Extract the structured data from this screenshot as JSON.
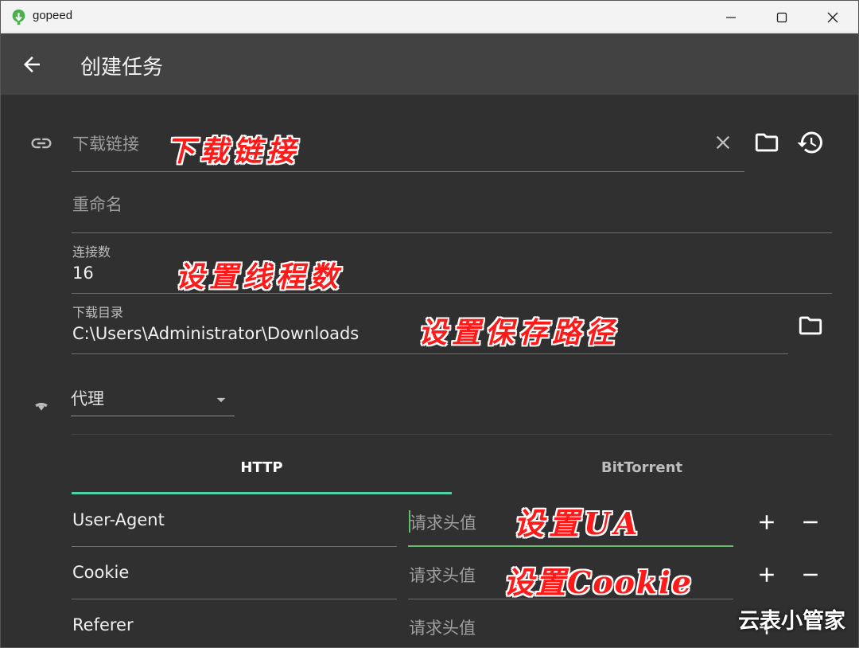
{
  "window": {
    "title": "gopeed"
  },
  "appbar": {
    "title": "创建任务"
  },
  "form": {
    "url": {
      "placeholder": "下载链接"
    },
    "rename": {
      "placeholder": "重命名"
    },
    "connections": {
      "label": "连接数",
      "value": "16"
    },
    "directory": {
      "label": "下载目录",
      "value": "C:\\Users\\Administrator\\Downloads"
    },
    "proxy": {
      "label": "代理"
    }
  },
  "tabs": [
    {
      "label": "HTTP",
      "selected": true
    },
    {
      "label": "BitTorrent",
      "selected": false
    }
  ],
  "headers": [
    {
      "name": "User-Agent",
      "value_placeholder": "请求头值"
    },
    {
      "name": "Cookie",
      "value_placeholder": "请求头值"
    },
    {
      "name": "Referer",
      "value_placeholder": "请求头值"
    }
  ],
  "annotations": {
    "url": "下载链接",
    "threads": "设置线程数",
    "path": "设置保存路径",
    "ua": "设置UA",
    "cookie": "设置Cookie"
  },
  "watermark": "云表小管家",
  "colors": {
    "accent": "#4fd1a5",
    "focus_line": "#66bb6a",
    "annotation": "#ff1a1a",
    "background": "#303030",
    "appbar": "#424242"
  },
  "icons": [
    "link-icon",
    "clear-icon",
    "folder-icon",
    "history-icon",
    "wifi-icon",
    "dropdown-arrow-icon",
    "plus-icon",
    "minus-icon",
    "back-arrow-icon"
  ]
}
